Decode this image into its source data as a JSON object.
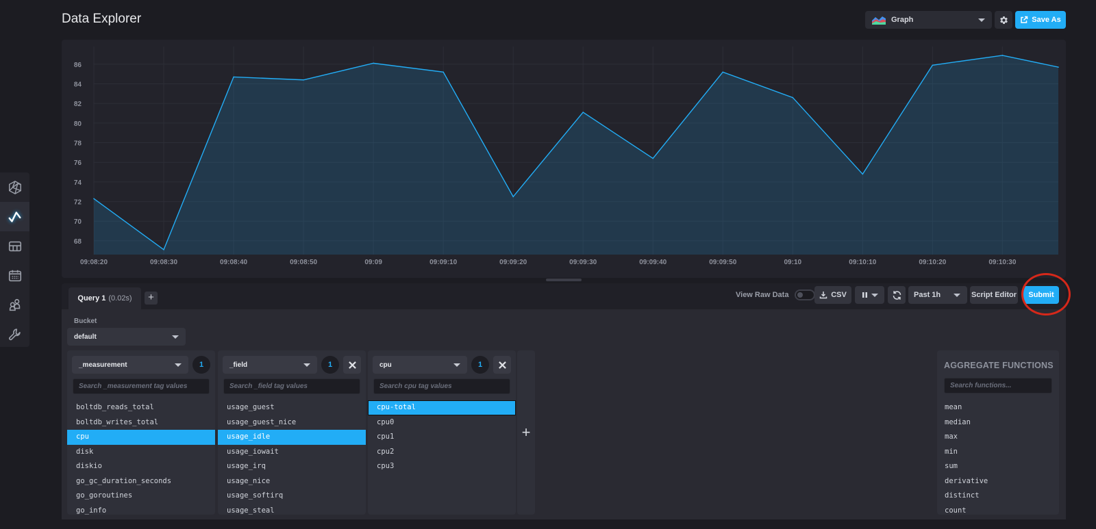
{
  "header": {
    "title": "Data Explorer",
    "visualization_select": "Graph",
    "save_as_label": "Save As"
  },
  "nav": {
    "items": [
      {
        "name": "dashboards-logo",
        "active": false
      },
      {
        "name": "data-explorer",
        "active": true
      },
      {
        "name": "dashboards",
        "active": false
      },
      {
        "name": "tasks",
        "active": false
      },
      {
        "name": "organizations",
        "active": false
      },
      {
        "name": "settings",
        "active": false
      }
    ]
  },
  "chart_data": {
    "type": "area",
    "title": "",
    "xlabel": "",
    "ylabel": "",
    "x": [
      "09:08:20",
      "09:08:30",
      "09:08:40",
      "09:08:50",
      "09:09:00",
      "09:09:10",
      "09:09:20",
      "09:09:30",
      "09:09:40",
      "09:09:50",
      "09:10:00",
      "09:10:10",
      "09:10:20",
      "09:10:30",
      "09:10:38"
    ],
    "x_seconds": [
      0,
      10,
      20,
      30,
      40,
      50,
      60,
      70,
      80,
      90,
      100,
      110,
      120,
      130,
      138
    ],
    "series": [
      {
        "name": "usage_idle cpu-total",
        "values": [
          72.3,
          67.1,
          84.7,
          84.4,
          86.1,
          85.2,
          72.5,
          81.1,
          76.4,
          85.2,
          82.6,
          74.8,
          85.9,
          86.9,
          85.7
        ],
        "color": "#22adf6"
      }
    ],
    "x_ticks": [
      "09:08:20",
      "09:08:30",
      "09:08:40",
      "09:08:50",
      "09:09",
      "09:09:10",
      "09:09:20",
      "09:09:30",
      "09:09:40",
      "09:09:50",
      "09:10",
      "09:10:10",
      "09:10:20",
      "09:10:30"
    ],
    "x_tick_seconds": [
      0,
      10,
      20,
      30,
      40,
      50,
      60,
      70,
      80,
      90,
      100,
      110,
      120,
      130
    ],
    "y_ticks": [
      68,
      70,
      72,
      74,
      76,
      78,
      80,
      82,
      84,
      86
    ],
    "ylim": [
      66.6,
      87.8
    ],
    "xlim": [
      0,
      138
    ],
    "grid": true,
    "legend": "none"
  },
  "query": {
    "tab_name": "Query 1",
    "tab_time": "(0.02s)",
    "add_query_label": "+",
    "view_raw_data_label": "View Raw Data",
    "view_raw_data_on": false,
    "csv_label": "CSV",
    "time_range": "Past 1h",
    "script_editor_label": "Script Editor",
    "submit_label": "Submit",
    "bucket_label": "Bucket",
    "bucket_value": "default"
  },
  "builder_cards": [
    {
      "key": "_measurement",
      "count": "1",
      "removable": false,
      "search_placeholder": "Search _measurement tag values",
      "items": [
        "boltdb_reads_total",
        "boltdb_writes_total",
        "cpu",
        "disk",
        "diskio",
        "go_gc_duration_seconds",
        "go_goroutines",
        "go_info"
      ],
      "selected": "cpu"
    },
    {
      "key": "_field",
      "count": "1",
      "removable": true,
      "search_placeholder": "Search _field tag values",
      "items": [
        "usage_guest",
        "usage_guest_nice",
        "usage_idle",
        "usage_iowait",
        "usage_irq",
        "usage_nice",
        "usage_softirq",
        "usage_steal"
      ],
      "selected": "usage_idle"
    },
    {
      "key": "cpu",
      "count": "1",
      "removable": true,
      "search_placeholder": "Search cpu tag values",
      "items": [
        "cpu-total",
        "cpu0",
        "cpu1",
        "cpu2",
        "cpu3"
      ],
      "selected": "cpu-total"
    }
  ],
  "add_card_label": "+",
  "aggregate": {
    "title": "AGGREGATE FUNCTIONS",
    "search_placeholder": "Search functions...",
    "functions": [
      "mean",
      "median",
      "max",
      "min",
      "sum",
      "derivative",
      "distinct",
      "count"
    ]
  },
  "colors": {
    "accent": "#22adf6",
    "annotation": "#d6281a",
    "background": "#1c1c22",
    "panel": "#23232b"
  }
}
